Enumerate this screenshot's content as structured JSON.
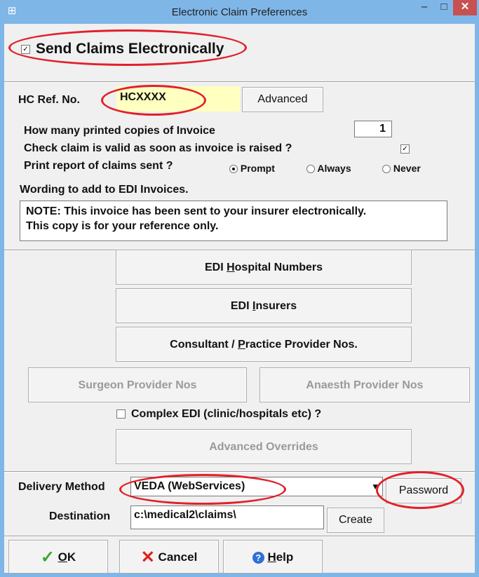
{
  "window": {
    "title": "Electronic Claim Preferences",
    "minimize": "–",
    "maximize": "□",
    "close": "✕"
  },
  "send_claims": {
    "checked": true,
    "label": "Send Claims Electronically"
  },
  "hc_ref": {
    "label": "HC Ref. No.",
    "value": "HCXXXX",
    "advanced_button": "Advanced"
  },
  "options": {
    "copies_label": "How many printed copies of Invoice",
    "copies_value": "1",
    "check_valid_label": "Check claim is valid as soon as invoice is raised ?",
    "check_valid_checked": true,
    "print_report_label": "Print report of claims sent ?",
    "print_report_options": [
      "Prompt",
      "Always",
      "Never"
    ],
    "print_report_selected": "Prompt",
    "wording_label": "Wording to add to EDI Invoices.",
    "wording_line1": "NOTE: This invoice has been sent to your insurer electronically.",
    "wording_line2": "This copy is for your reference only."
  },
  "buttons": {
    "hospital_pre": "EDI ",
    "hospital_key": "H",
    "hospital_post": "ospital Numbers",
    "insurers_pre": "EDI ",
    "insurers_key": "I",
    "insurers_post": "nsurers",
    "consultant_pre": "Consultant / ",
    "consultant_key": "P",
    "consultant_post": "ractice Provider Nos.",
    "surgeon": "Surgeon Provider Nos",
    "anaesth": "Anaesth Provider Nos",
    "complex_label": "Complex EDI (clinic/hospitals etc) ?",
    "complex_checked": false,
    "advanced_overrides": "Advanced Overrides"
  },
  "delivery": {
    "method_label": "Delivery Method",
    "method_value": "VEDA (WebServices)",
    "password_button": "Password",
    "destination_label": "Destination",
    "destination_value": "c:\\medical2\\claims\\",
    "create_button": "Create"
  },
  "footer": {
    "ok_key": "O",
    "ok_rest": "K",
    "cancel": "Cancel",
    "help_key": "H",
    "help_rest": "elp"
  },
  "colors": {
    "titlebar": "#7fb6e8",
    "highlight_input": "#ffffc0",
    "annotation_red": "#e2202a",
    "ok_check": "#3aa635",
    "cancel_x": "#e02020",
    "help_icon": "#2f6fd6"
  }
}
